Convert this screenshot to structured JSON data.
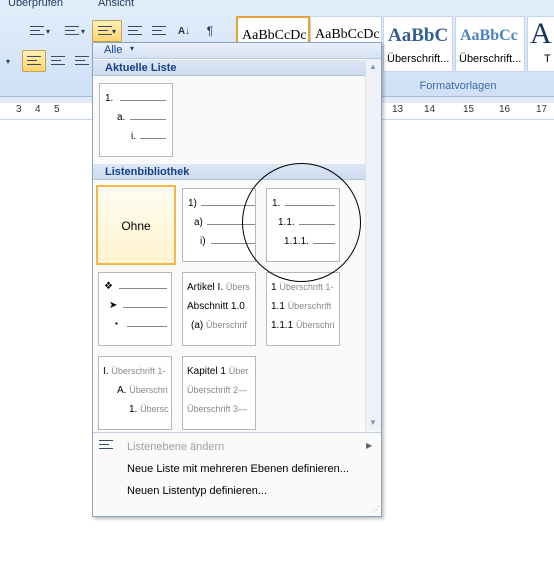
{
  "ribbon": {
    "tabs": [
      "Überprüfen",
      "Ansicht"
    ],
    "styles": [
      {
        "sample": "AaBbCcDc",
        "name": "",
        "kind": "normal",
        "selected": true
      },
      {
        "sample": "AaBbCcDc",
        "name": "",
        "kind": "normal",
        "selected": false
      },
      {
        "sample": "AaBbC",
        "name": "Überschrift...",
        "kind": "big",
        "selected": false
      },
      {
        "sample": "AaBbCc",
        "name": "Überschrift...",
        "kind": "mid",
        "selected": false
      },
      {
        "sample": "A",
        "name": "T",
        "kind": "big",
        "selected": false
      }
    ],
    "group_label": "Formatvorlagen",
    "pilcrow": "¶",
    "sort_icon": "sort-az-icon",
    "ruler_numbers": [
      "3",
      "4",
      "5",
      "13",
      "14",
      "15",
      "16",
      "17"
    ]
  },
  "gallery": {
    "filter": {
      "label": "Alle",
      "arrow": "▾"
    },
    "current_section": "Aktuelle Liste",
    "current_list": {
      "l1": "1.",
      "l2": "a.",
      "l3": "i."
    },
    "library_section": "Listenbibliothek",
    "library": {
      "none_label": "Ohne",
      "paren": {
        "l1": "1)",
        "l2": "a)",
        "l3": "i)"
      },
      "decimal": {
        "l1": "1.",
        "l2": "1.1.",
        "l3": "1.1.1."
      },
      "bullets": {
        "l1": "❖",
        "l2": "➤",
        "l3": "▪"
      },
      "article": {
        "l1a": "Artikel I.",
        "l1b": "Übers",
        "l2a": "Abschnitt 1.0",
        "l2b": "",
        "l3a": "(a)",
        "l3b": "Überschrif"
      },
      "heading_decimal": {
        "l1a": "1",
        "l1b": "Überschrift 1-",
        "l2a": "1.1",
        "l2b": "Überschrift",
        "l3a": "1.1.1",
        "l3b": "Überschri"
      },
      "heading_roman": {
        "l1a": "I.",
        "l1b": "Überschrift 1-",
        "l2a": "A.",
        "l2b": "Überschri",
        "l3a": "1.",
        "l3b": "Übersc"
      },
      "chapter": {
        "l1a": "Kapitel 1",
        "l1b": "Über",
        "l2a": "Überschrift 2—",
        "l3a": "Überschrift 3—"
      }
    },
    "menu": {
      "change_level": "Listenebene ändern",
      "define_multilevel": "Neue Liste mit mehreren Ebenen definieren...",
      "define_style": "Neuen Listentyp definieren..."
    }
  },
  "colors": {
    "accent": "#f2b84b",
    "section_text": "#15428b",
    "ribbon": "#dae6f6"
  }
}
